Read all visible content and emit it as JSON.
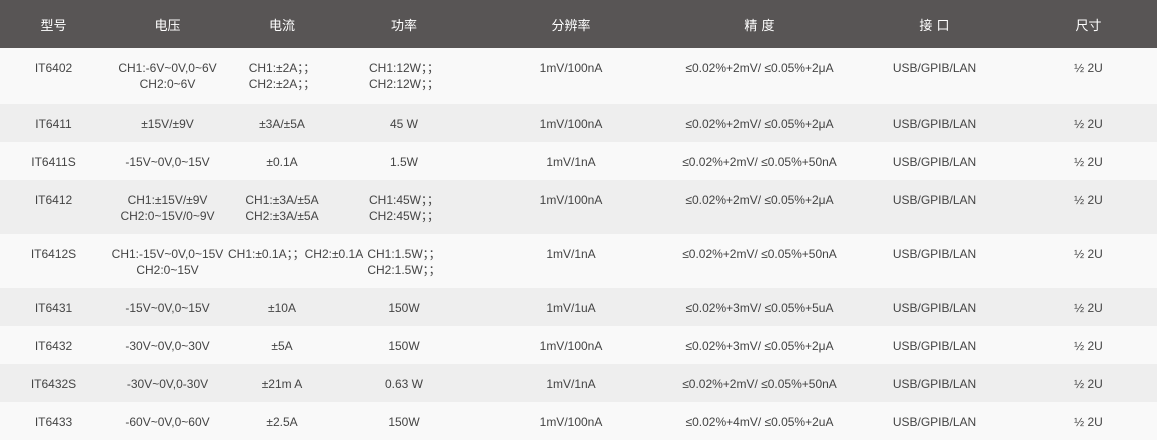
{
  "headers": [
    "型号",
    "电压",
    "电流",
    "功率",
    "分辨率",
    "精 度",
    "接 口",
    "尺寸"
  ],
  "rows": [
    {
      "model": "IT6402",
      "voltage": [
        "CH1:-6V~0V,0~6V",
        "CH2:0~6V"
      ],
      "current": [
        "CH1:±2A；；",
        "CH2:±2A；；"
      ],
      "power": [
        "CH1:12W；；",
        "CH2:12W；；"
      ],
      "resolution": "1mV/100nA",
      "accuracy": "≤0.02%+2mV/ ≤0.05%+2μA",
      "interface": "USB/GPIB/LAN",
      "size": "½ 2U"
    },
    {
      "model": "IT6411",
      "voltage": [
        "±15V/±9V"
      ],
      "current": [
        "±3A/±5A"
      ],
      "power": [
        "45 W"
      ],
      "resolution": "1mV/100nA",
      "accuracy": "≤0.02%+2mV/ ≤0.05%+2μA",
      "interface": "USB/GPIB/LAN",
      "size": "½ 2U"
    },
    {
      "model": "IT6411S",
      "voltage": [
        "-15V~0V,0~15V"
      ],
      "current": [
        "±0.1A"
      ],
      "power": [
        "1.5W"
      ],
      "resolution": "1mV/1nA",
      "accuracy": "≤0.02%+2mV/ ≤0.05%+50nA",
      "interface": "USB/GPIB/LAN",
      "size": "½ 2U"
    },
    {
      "model": "IT6412",
      "voltage": [
        "CH1:±15V/±9V",
        "CH2:0~15V/0~9V"
      ],
      "current": [
        "CH1:±3A/±5A",
        "CH2:±3A/±5A"
      ],
      "power": [
        "CH1:45W；；",
        "CH2:45W；；"
      ],
      "resolution": "1mV/100nA",
      "accuracy": "≤0.02%+2mV/ ≤0.05%+2μA",
      "interface": "USB/GPIB/LAN",
      "size": "½ 2U"
    },
    {
      "model": "IT6412S",
      "voltage": [
        "CH1:-15V~0V,0~15V",
        "CH2:0~15V"
      ],
      "current": [
        "CH1:±0.1A；；CH2:±0.1A"
      ],
      "power": [
        "CH1:1.5W；；",
        "CH2:1.5W；；"
      ],
      "resolution": "1mV/1nA",
      "accuracy": "≤0.02%+2mV/ ≤0.05%+50nA",
      "interface": "USB/GPIB/LAN",
      "size": "½ 2U"
    },
    {
      "model": "IT6431",
      "voltage": [
        "-15V~0V,0~15V"
      ],
      "current": [
        "±10A"
      ],
      "power": [
        "150W"
      ],
      "resolution": "1mV/1uA",
      "accuracy": "≤0.02%+3mV/ ≤0.05%+5uA",
      "interface": "USB/GPIB/LAN",
      "size": "½ 2U"
    },
    {
      "model": "IT6432",
      "voltage": [
        "-30V~0V,0~30V"
      ],
      "current": [
        "±5A"
      ],
      "power": [
        "150W"
      ],
      "resolution": "1mV/100nA",
      "accuracy": "≤0.02%+3mV/ ≤0.05%+2μA",
      "interface": "USB/GPIB/LAN",
      "size": "½ 2U"
    },
    {
      "model": "IT6432S",
      "voltage": [
        "-30V~0V,0-30V"
      ],
      "current": [
        "±21m A"
      ],
      "power": [
        "0.63 W"
      ],
      "resolution": "1mV/1nA",
      "accuracy": "≤0.02%+2mV/ ≤0.05%+50nA",
      "interface": "USB/GPIB/LAN",
      "size": "½ 2U"
    },
    {
      "model": "IT6433",
      "voltage": [
        "-60V~0V,0~60V"
      ],
      "current": [
        "±2.5A"
      ],
      "power": [
        "150W"
      ],
      "resolution": "1mV/100nA",
      "accuracy": "≤0.02%+4mV/ ≤0.05%+2uA",
      "interface": "USB/GPIB/LAN",
      "size": "½ 2U"
    }
  ]
}
